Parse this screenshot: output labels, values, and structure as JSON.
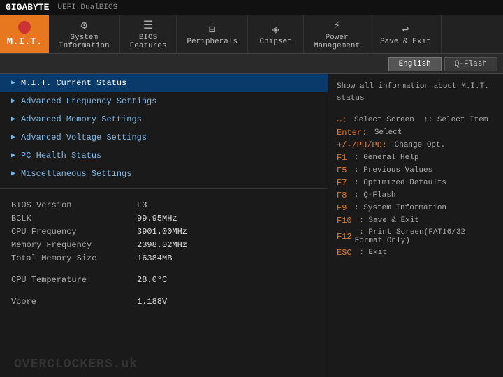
{
  "brand": "GIGABYTE",
  "dual_bios": "UEFI DualBIOS",
  "mit_label": "M.I.T.",
  "nav": {
    "items": [
      {
        "id": "system-information",
        "icon": "⚙",
        "line1": "System",
        "line2": "Information"
      },
      {
        "id": "bios-features",
        "icon": "☰",
        "line1": "BIOS",
        "line2": "Features"
      },
      {
        "id": "peripherals",
        "icon": "⊞",
        "line1": "Peripherals",
        "line2": ""
      },
      {
        "id": "chipset",
        "icon": "◈",
        "line1": "Chipset",
        "line2": ""
      },
      {
        "id": "power-management",
        "icon": "⚡",
        "line1": "Power",
        "line2": "Management"
      },
      {
        "id": "save-exit",
        "icon": "↩",
        "line1": "Save & Exit",
        "line2": ""
      }
    ]
  },
  "lang": {
    "english_label": "English",
    "qflash_label": "Q-Flash"
  },
  "menu": {
    "items": [
      {
        "id": "mit-current-status",
        "label": "M.I.T. Current Status",
        "selected": true
      },
      {
        "id": "advanced-frequency",
        "label": "Advanced Frequency Settings",
        "selected": false
      },
      {
        "id": "advanced-memory",
        "label": "Advanced Memory Settings",
        "selected": false
      },
      {
        "id": "advanced-voltage",
        "label": "Advanced Voltage Settings",
        "selected": false
      },
      {
        "id": "pc-health-status",
        "label": "PC Health Status",
        "selected": false
      },
      {
        "id": "miscellaneous",
        "label": "Miscellaneous Settings",
        "selected": false
      }
    ]
  },
  "info": {
    "bios_version_label": "BIOS Version",
    "bios_version_value": "F3",
    "bclk_label": "BCLK",
    "bclk_value": "99.95MHz",
    "cpu_freq_label": "CPU Frequency",
    "cpu_freq_value": "3901.00MHz",
    "mem_freq_label": "Memory Frequency",
    "mem_freq_value": "2398.02MHz",
    "total_mem_label": "Total Memory Size",
    "total_mem_value": "16384MB",
    "cpu_temp_label": "CPU Temperature",
    "cpu_temp_value": "28.0°C",
    "vcore_label": "Vcore",
    "vcore_value": "1.188V"
  },
  "right_panel": {
    "status_desc": "Show all information about M.I.T. status",
    "keybinds": [
      {
        "key": "↔:",
        "desc": "Select Screen  ↕: Select Item"
      },
      {
        "key": "Enter:",
        "desc": "Select"
      },
      {
        "key": "+/-/PU/PD:",
        "desc": "Change Opt."
      },
      {
        "key": "F1",
        "desc": ": General Help"
      },
      {
        "key": "F5",
        "desc": ": Previous Values"
      },
      {
        "key": "F7",
        "desc": ": Optimized Defaults"
      },
      {
        "key": "F8",
        "desc": ": Q-Flash"
      },
      {
        "key": "F9",
        "desc": ": System Information"
      },
      {
        "key": "F10",
        "desc": ": Save & Exit"
      },
      {
        "key": "F12",
        "desc": ": Print Screen(FAT16/32 Format Only)"
      },
      {
        "key": "ESC",
        "desc": ": Exit"
      }
    ]
  },
  "watermark": "OVERCLOCKERS.uk"
}
